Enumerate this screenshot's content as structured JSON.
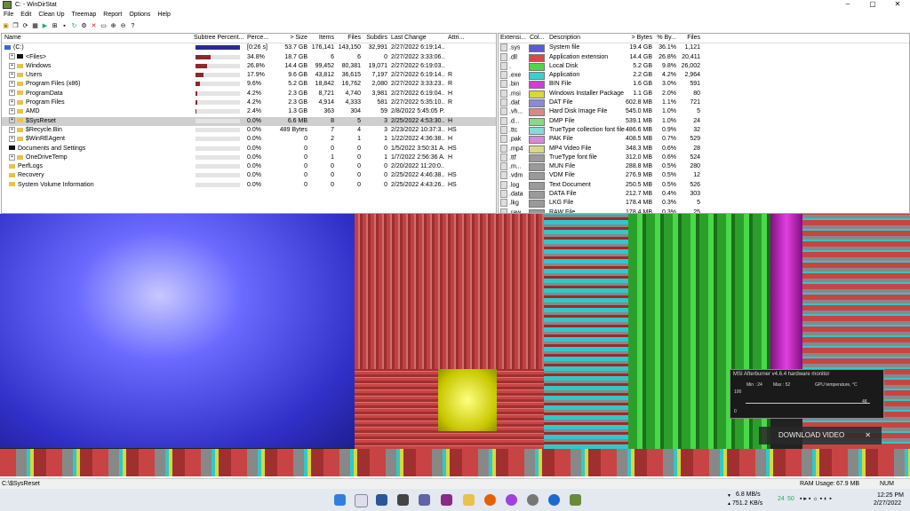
{
  "window": {
    "title": "C: - WinDirStat",
    "controls": [
      "–",
      "▢",
      "✕"
    ]
  },
  "menu": [
    "File",
    "Edit",
    "Clean Up",
    "Treemap",
    "Report",
    "Options",
    "Help"
  ],
  "toolbar": [
    "open-icon",
    "copy-icon",
    "refresh-icon",
    "select-icon",
    "explorer-icon",
    "prompt-icon",
    "refresh-all-icon",
    "stop-icon",
    "play-icon",
    "delete-icon",
    "properties-icon",
    "zoom-in-icon",
    "zoom-out-icon",
    "help-icon"
  ],
  "dirlist": {
    "headers": [
      "Name",
      "Subtree Percent...",
      "Perce...",
      "> Size",
      "Items",
      "Files",
      "Subdirs",
      "Last Change",
      "Attri..."
    ],
    "rows": [
      {
        "name": "(C:)",
        "subtree": 100,
        "pct": "[0:26 s]",
        "size": "53.7 GB",
        "items": "176,141",
        "files": "143,150",
        "subdirs": "32,991",
        "change": "2/27/2022 6:19:14...",
        "attr": "",
        "root": true
      },
      {
        "name": "<Files>",
        "subtree": 34.8,
        "pct": "34.8%",
        "size": "18.7 GB",
        "items": "6",
        "files": "6",
        "subdirs": "0",
        "change": "2/27/2022 3:33:06...",
        "attr": "",
        "black": true
      },
      {
        "name": "Windows",
        "subtree": 26.8,
        "pct": "26.8%",
        "size": "14.4 GB",
        "items": "99,452",
        "files": "80,381",
        "subdirs": "19,071",
        "change": "2/27/2022 6:19:03...",
        "attr": ""
      },
      {
        "name": "Users",
        "subtree": 17.9,
        "pct": "17.9%",
        "size": "9.6 GB",
        "items": "43,812",
        "files": "36,615",
        "subdirs": "7,197",
        "change": "2/27/2022 6:19:14...",
        "attr": "R"
      },
      {
        "name": "Program Files (x86)",
        "subtree": 9.6,
        "pct": "9.6%",
        "size": "5.2 GB",
        "items": "18,842",
        "files": "16,762",
        "subdirs": "2,080",
        "change": "2/27/2022 3:33:23...",
        "attr": "R"
      },
      {
        "name": "ProgramData",
        "subtree": 4.2,
        "pct": "4.2%",
        "size": "2.3 GB",
        "items": "8,721",
        "files": "4,740",
        "subdirs": "3,981",
        "change": "2/27/2022 6:19:04...",
        "attr": "H"
      },
      {
        "name": "Program Files",
        "subtree": 4.2,
        "pct": "4.2%",
        "size": "2.3 GB",
        "items": "4,914",
        "files": "4,333",
        "subdirs": "581",
        "change": "2/27/2022 5:35:10...",
        "attr": "R"
      },
      {
        "name": "AMD",
        "subtree": 2.4,
        "pct": "2.4%",
        "size": "1.3 GB",
        "items": "363",
        "files": "304",
        "subdirs": "59",
        "change": "2/8/2022 5:45:05 P...",
        "attr": ""
      },
      {
        "name": "$SysReset",
        "subtree": 0,
        "pct": "0.0%",
        "size": "6.6 MB",
        "items": "8",
        "files": "5",
        "subdirs": "3",
        "change": "2/25/2022 4:53:30...",
        "attr": "H",
        "selected": true
      },
      {
        "name": "$Recycle.Bin",
        "subtree": 0,
        "pct": "0.0%",
        "size": "489 Bytes",
        "items": "7",
        "files": "4",
        "subdirs": "3",
        "change": "2/23/2022 10:37:3...",
        "attr": "HS"
      },
      {
        "name": "$WinREAgent",
        "subtree": 0,
        "pct": "0.0%",
        "size": "0",
        "items": "2",
        "files": "1",
        "subdirs": "1",
        "change": "1/22/2022 4:36:38...",
        "attr": "H"
      },
      {
        "name": "Documents and Settings",
        "subtree": 0,
        "pct": "0.0%",
        "size": "0",
        "items": "0",
        "files": "0",
        "subdirs": "0",
        "change": "1/5/2022 3:50:31 A...",
        "attr": "HS",
        "black": true
      },
      {
        "name": "OneDriveTemp",
        "subtree": 0,
        "pct": "0.0%",
        "size": "0",
        "items": "1",
        "files": "0",
        "subdirs": "1",
        "change": "1/7/2022 2:56:36 A...",
        "attr": "H"
      },
      {
        "name": "PerfLogs",
        "subtree": 0,
        "pct": "0.0%",
        "size": "0",
        "items": "0",
        "files": "0",
        "subdirs": "0",
        "change": "2/20/2022 11:20:0...",
        "attr": ""
      },
      {
        "name": "Recovery",
        "subtree": 0,
        "pct": "0.0%",
        "size": "0",
        "items": "0",
        "files": "0",
        "subdirs": "0",
        "change": "2/25/2022 4:46:38...",
        "attr": "HS"
      },
      {
        "name": "System Volume Information",
        "subtree": 0,
        "pct": "0.0%",
        "size": "0",
        "items": "0",
        "files": "0",
        "subdirs": "0",
        "change": "2/25/2022 4:43:26...",
        "attr": "HS"
      }
    ]
  },
  "extlist": {
    "headers": [
      "Extensi...",
      "Col...",
      "Description",
      "> Bytes",
      "% By...",
      "Files"
    ],
    "rows": [
      {
        "ext": ".sys",
        "color": "#5a5ad8",
        "desc": "System file",
        "bytes": "19.4 GB",
        "pct": "36.1%",
        "files": "1,121"
      },
      {
        "ext": ".dll",
        "color": "#d84a4a",
        "desc": "Application extension",
        "bytes": "14.4 GB",
        "pct": "26.8%",
        "files": "20,411"
      },
      {
        "ext": ".",
        "color": "#4ad84a",
        "desc": "Local Disk",
        "bytes": "5.2 GB",
        "pct": "9.8%",
        "files": "26,002"
      },
      {
        "ext": ".exe",
        "color": "#3ad0d0",
        "desc": "Application",
        "bytes": "2.2 GB",
        "pct": "4.2%",
        "files": "2,964"
      },
      {
        "ext": ".bin",
        "color": "#d83ad8",
        "desc": "BIN File",
        "bytes": "1.6 GB",
        "pct": "3.0%",
        "files": "591"
      },
      {
        "ext": ".msi",
        "color": "#d8d83a",
        "desc": "Windows Installer Package",
        "bytes": "1.1 GB",
        "pct": "2.0%",
        "files": "80"
      },
      {
        "ext": ".dat",
        "color": "#8a8ad8",
        "desc": "DAT File",
        "bytes": "602.8 MB",
        "pct": "1.1%",
        "files": "721"
      },
      {
        "ext": ".vh...",
        "color": "#d88a8a",
        "desc": "Hard Disk Image File",
        "bytes": "545.0 MB",
        "pct": "1.0%",
        "files": "5"
      },
      {
        "ext": ".d...",
        "color": "#8ad88a",
        "desc": "DMP File",
        "bytes": "539.1 MB",
        "pct": "1.0%",
        "files": "24"
      },
      {
        "ext": ".ttc",
        "color": "#8ad8d8",
        "desc": "TrueType collection font file",
        "bytes": "486.6 MB",
        "pct": "0.9%",
        "files": "32"
      },
      {
        "ext": ".pak",
        "color": "#d88ad8",
        "desc": "PAK File",
        "bytes": "408.5 MB",
        "pct": "0.7%",
        "files": "529"
      },
      {
        "ext": ".mp4",
        "color": "#d8d88a",
        "desc": "MP4 Video File",
        "bytes": "348.3 MB",
        "pct": "0.6%",
        "files": "28"
      },
      {
        "ext": ".ttf",
        "color": "#9a9a9a",
        "desc": "TrueType font file",
        "bytes": "312.0 MB",
        "pct": "0.6%",
        "files": "524"
      },
      {
        "ext": ".m...",
        "color": "#9a9a9a",
        "desc": "MUN File",
        "bytes": "288.8 MB",
        "pct": "0.5%",
        "files": "280"
      },
      {
        "ext": ".vdm",
        "color": "#9a9a9a",
        "desc": "VDM File",
        "bytes": "276.9 MB",
        "pct": "0.5%",
        "files": "12"
      },
      {
        "ext": ".log",
        "color": "#9a9a9a",
        "desc": "Text Document",
        "bytes": "250.5 MB",
        "pct": "0.5%",
        "files": "526"
      },
      {
        "ext": ".data",
        "color": "#9a9a9a",
        "desc": "DATA File",
        "bytes": "212.7 MB",
        "pct": "0.4%",
        "files": "303"
      },
      {
        "ext": ".lkg",
        "color": "#9a9a9a",
        "desc": "LKG File",
        "bytes": "178.4 MB",
        "pct": "0.3%",
        "files": "5"
      },
      {
        "ext": ".raw",
        "color": "#9a9a9a",
        "desc": "RAW File",
        "bytes": "178.4 MB",
        "pct": "0.3%",
        "files": "25"
      }
    ]
  },
  "overlay": {
    "msi_title": "MSI Afterburner v4.6.4 hardware monitor",
    "msi_min": "Min : 24",
    "msi_max": "Max : 52",
    "msi_label": "GPU temperature, °C",
    "msi_top": "100",
    "msi_zero": "0",
    "msi_value": "48",
    "download": "DOWNLOAD VIDEO",
    "download_close": "✕"
  },
  "status": {
    "path": "C:\\$SysReset",
    "ram_label": "RAM Usage:",
    "ram_value": "67.9 MB",
    "num": "NUM"
  },
  "taskbar": {
    "net_down": "6.8 MB/s",
    "net_up": "751.2 KB/s",
    "time": "12:25 PM",
    "date": "2/27/2022",
    "tray_temps": [
      "24",
      "50"
    ]
  },
  "colors": {
    "treemap_sys": "#5a5ad8",
    "treemap_dll": "#d84a4a",
    "treemap_green": "#4ad84a",
    "selection": "#cfcfcf"
  }
}
